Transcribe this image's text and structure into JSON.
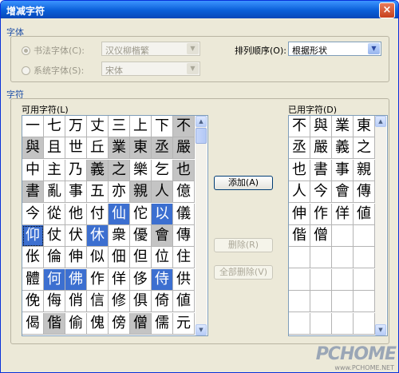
{
  "window": {
    "title": "增减字符",
    "close_label": "×"
  },
  "font_group": {
    "label": "字体",
    "calligraphy_radio": "书法字体(C):",
    "calligraphy_value": "汉仪柳楷繁",
    "system_radio": "系统字体(S):",
    "system_value": "宋体",
    "sort_label": "排列顺序(O):",
    "sort_value": "根据形状"
  },
  "chars_group": {
    "label": "字符",
    "available_label": "可用字符(L)",
    "used_label": "已用字符(D)"
  },
  "available_chars": [
    [
      "一",
      "七",
      "万",
      "丈",
      "三",
      "上",
      "下",
      "不"
    ],
    [
      "與",
      "且",
      "世",
      "丘",
      "業",
      "東",
      "丞",
      "嚴"
    ],
    [
      "中",
      "主",
      "乃",
      "義",
      "之",
      "樂",
      "乞",
      "也"
    ],
    [
      "書",
      "亂",
      "事",
      "五",
      "亦",
      "親",
      "人",
      "億"
    ],
    [
      "今",
      "從",
      "他",
      "付",
      "仙",
      "佗",
      "以",
      "儀"
    ],
    [
      "仰",
      "仗",
      "伏",
      "休",
      "衆",
      "優",
      "會",
      "傳"
    ],
    [
      "伥",
      "倫",
      "伸",
      "似",
      "佃",
      "但",
      "位",
      "住"
    ],
    [
      "體",
      "何",
      "佛",
      "作",
      "佯",
      "侈",
      "侍",
      "供"
    ],
    [
      "俛",
      "侮",
      "俏",
      "信",
      "修",
      "俱",
      "倚",
      "値"
    ],
    [
      "偈",
      "偕",
      "偷",
      "傀",
      "傍",
      "僧",
      "儒",
      "元"
    ]
  ],
  "available_highlight": [
    [
      "w",
      "w",
      "w",
      "w",
      "w",
      "w",
      "w",
      "g"
    ],
    [
      "g",
      "w",
      "w",
      "w",
      "g",
      "g",
      "g",
      "g"
    ],
    [
      "w",
      "w",
      "w",
      "g",
      "g",
      "w",
      "w",
      "g"
    ],
    [
      "g",
      "w",
      "w",
      "w",
      "w",
      "g",
      "g",
      "w"
    ],
    [
      "w",
      "w",
      "w",
      "w",
      "b",
      "w",
      "b",
      "w"
    ],
    [
      "b",
      "w",
      "w",
      "b",
      "w",
      "w",
      "g",
      "w"
    ],
    [
      "w",
      "w",
      "w",
      "w",
      "w",
      "w",
      "w",
      "w"
    ],
    [
      "w",
      "b",
      "b",
      "w",
      "w",
      "w",
      "b",
      "w"
    ],
    [
      "w",
      "w",
      "w",
      "w",
      "w",
      "w",
      "w",
      "w"
    ],
    [
      "w",
      "g",
      "w",
      "w",
      "w",
      "g",
      "w",
      "w"
    ]
  ],
  "used_chars": [
    [
      "不",
      "與",
      "業",
      "東"
    ],
    [
      "丞",
      "嚴",
      "義",
      "之"
    ],
    [
      "也",
      "書",
      "事",
      "親"
    ],
    [
      "人",
      "今",
      "會",
      "傳"
    ],
    [
      "伸",
      "作",
      "佯",
      "値"
    ],
    [
      "偕",
      "僧",
      "",
      ""
    ],
    [
      "",
      "",
      "",
      ""
    ],
    [
      "",
      "",
      "",
      ""
    ],
    [
      "",
      "",
      "",
      ""
    ],
    [
      "",
      "",
      "",
      ""
    ]
  ],
  "buttons": {
    "add": "添加(A)",
    "delete": "删除(R)",
    "delete_all": "全部删除(V)"
  },
  "watermark": {
    "brand": "PCHOME",
    "url": "www.PCHOME.NET"
  },
  "colors": {
    "titlebar": "#0a5fd8",
    "selection": "#3c6fd0",
    "used_gray": "#c4c4c4",
    "group_label": "#1f4fa6"
  }
}
